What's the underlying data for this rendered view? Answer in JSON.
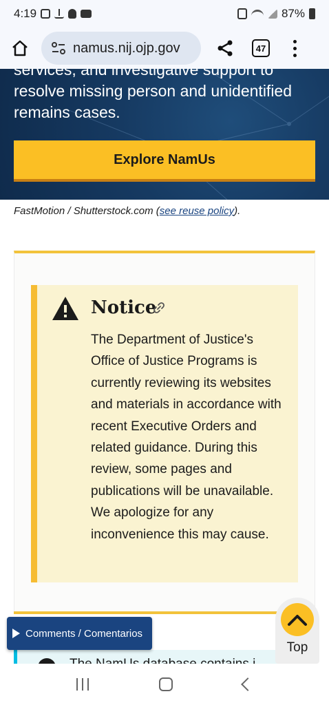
{
  "status_bar": {
    "time": "4:19",
    "battery": "87%"
  },
  "browser": {
    "url": "namus.nij.ojp.gov",
    "tab_count": "47"
  },
  "hero": {
    "text": "services, and investigative support to resolve missing person and unidentified remains cases.",
    "button_label": "Explore NamUs"
  },
  "credit": {
    "prefix": "FastMotion / Shutterstock.com (",
    "link": "see reuse policy",
    "suffix": ")."
  },
  "notice": {
    "title": "Notice",
    "body": "The Department of Justice's Office of Justice Programs is currently reviewing its websites and materials in accordance with recent Executive Orders and related guidance. During this review, some pages and publications will be unavailable. We apologize for any inconvenience this may cause."
  },
  "info": {
    "text": "The NamUs database contains i"
  },
  "comments_button": "Comments / Comentarios",
  "top_button": "Top",
  "colors": {
    "accent_yellow": "#fbbf24",
    "navy": "#1a4480",
    "notice_bg": "#faf3d1"
  }
}
